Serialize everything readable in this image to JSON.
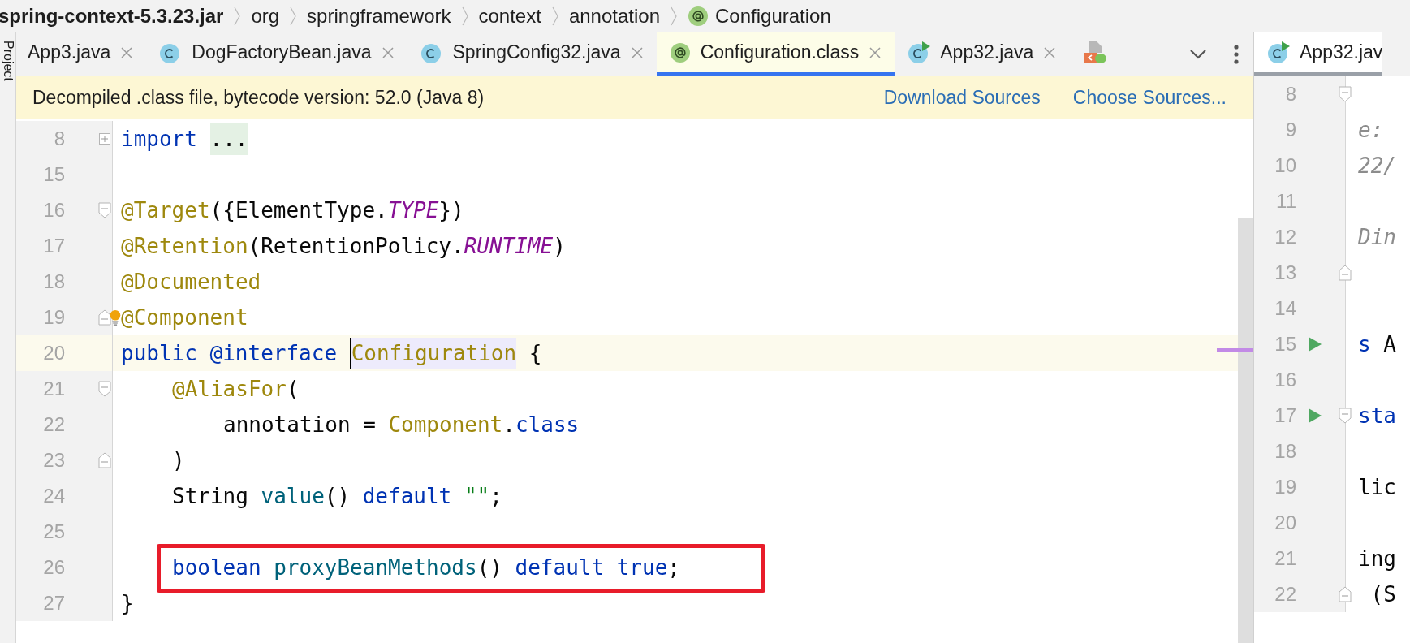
{
  "side_strip": {
    "label": "Project"
  },
  "breadcrumb": [
    {
      "label": "spring-context-5.3.23.jar",
      "kind": "jar"
    },
    {
      "label": "org",
      "kind": "package"
    },
    {
      "label": "springframework",
      "kind": "package"
    },
    {
      "label": "context",
      "kind": "package"
    },
    {
      "label": "annotation",
      "kind": "package"
    },
    {
      "label": "Configuration",
      "kind": "annotation"
    }
  ],
  "tabs": [
    {
      "label": "App3.java",
      "kind": "plain",
      "selected": false
    },
    {
      "label": "DogFactoryBean.java",
      "kind": "class",
      "selected": false
    },
    {
      "label": "SpringConfig32.java",
      "kind": "class",
      "selected": false
    },
    {
      "label": "Configuration.class",
      "kind": "annotation",
      "selected": true
    },
    {
      "label": "App32.java",
      "kind": "runnable",
      "selected": false
    },
    {
      "kind": "spring",
      "selected": false
    }
  ],
  "banner": {
    "text": "Decompiled .class file, bytecode version: 52.0 (Java 8)",
    "links": [
      "Download Sources",
      "Choose Sources..."
    ]
  },
  "editor": {
    "lines": [
      {
        "number": "8",
        "collapsed": true,
        "tokens": [
          {
            "kind": "kw",
            "text": "import"
          },
          {
            "kind": "folded",
            "text": "...",
            "spaced": true
          }
        ]
      },
      {
        "number": "15"
      },
      {
        "number": "16",
        "fold_open": true,
        "tokens": [
          {
            "kind": "ann",
            "text": "@Target"
          },
          {
            "kind": "plain",
            "text": "({ElementType."
          },
          {
            "kind": "const",
            "text": "TYPE"
          },
          {
            "kind": "plain",
            "text": "})"
          }
        ]
      },
      {
        "number": "17",
        "tokens": [
          {
            "kind": "ann",
            "text": "@Retention"
          },
          {
            "kind": "plain",
            "text": "(RetentionPolicy."
          },
          {
            "kind": "const",
            "text": "RUNTIME"
          },
          {
            "kind": "plain",
            "text": ")"
          }
        ]
      },
      {
        "number": "18",
        "tokens": [
          {
            "kind": "ann",
            "text": "@Documented"
          }
        ]
      },
      {
        "number": "19",
        "fold_close": true,
        "bulb": true,
        "tokens": [
          {
            "kind": "ann",
            "text": "@Component"
          }
        ]
      },
      {
        "number": "20",
        "current": true,
        "tokens": [
          {
            "kind": "kw",
            "text": "public"
          },
          {
            "kind": "kw",
            "text": "@interface",
            "spaced": true
          },
          {
            "kind": "ann",
            "text": "Configuration",
            "spaced": true,
            "highlighted": true
          },
          {
            "kind": "plain",
            "text": "{",
            "spaced": true
          }
        ]
      },
      {
        "number": "21",
        "fold_open": true,
        "indented": true,
        "tokens": [
          {
            "kind": "ann",
            "text": "@AliasFor"
          },
          {
            "kind": "plain",
            "text": "("
          }
        ]
      },
      {
        "number": "22",
        "indented": true,
        "deeper": true,
        "tokens": [
          {
            "kind": "plain",
            "text": "annotation"
          },
          {
            "kind": "plain",
            "text": "=",
            "spaced": true
          },
          {
            "kind": "ann",
            "text": "Component",
            "spaced": true
          },
          {
            "kind": "plain",
            "text": "."
          },
          {
            "kind": "kw",
            "text": "class"
          }
        ]
      },
      {
        "number": "23",
        "fold_close": true,
        "indented": true,
        "tokens": [
          {
            "kind": "plain",
            "text": ")"
          }
        ]
      },
      {
        "number": "24",
        "indented": true,
        "tokens": [
          {
            "kind": "plain",
            "text": "String"
          },
          {
            "kind": "method",
            "text": "value",
            "spaced": true
          },
          {
            "kind": "plain",
            "text": "()"
          },
          {
            "kind": "kw",
            "text": "default",
            "spaced": true
          },
          {
            "kind": "str",
            "text": "\"\"",
            "spaced": true
          },
          {
            "kind": "plain",
            "text": ";"
          }
        ]
      },
      {
        "number": "25"
      },
      {
        "number": "26",
        "boxed": true,
        "indented": true,
        "tokens": [
          {
            "kind": "kw",
            "text": "boolean"
          },
          {
            "kind": "method",
            "text": "proxyBeanMethods",
            "spaced": true
          },
          {
            "kind": "plain",
            "text": "()"
          },
          {
            "kind": "kw",
            "text": "default",
            "spaced": true
          },
          {
            "kind": "kw",
            "text": "true",
            "spaced": true
          },
          {
            "kind": "plain",
            "text": ";"
          }
        ]
      },
      {
        "number": "27",
        "tokens": [
          {
            "kind": "plain",
            "text": "}"
          }
        ]
      }
    ]
  },
  "side_editor": {
    "tab": {
      "label": "App32.jav",
      "kind": "runnable",
      "selected": true
    },
    "lines": [
      {
        "number": "8",
        "fold_open": true
      },
      {
        "number": "9",
        "tokens": [
          {
            "kind": "comment",
            "text": "e:"
          }
        ]
      },
      {
        "number": "10",
        "tokens": [
          {
            "kind": "comment",
            "text": "22/"
          }
        ]
      },
      {
        "number": "11"
      },
      {
        "number": "12",
        "tokens": [
          {
            "kind": "comment",
            "text": "Din"
          }
        ]
      },
      {
        "number": "13",
        "fold_close": true
      },
      {
        "number": "14"
      },
      {
        "number": "15",
        "run": true,
        "tokens": [
          {
            "kind": "kw",
            "text": "s"
          },
          {
            "kind": "plain",
            "text": "A",
            "spaced": true
          }
        ]
      },
      {
        "number": "16"
      },
      {
        "number": "17",
        "fold_open": true,
        "run": true,
        "tokens": [
          {
            "kind": "kw",
            "text": "sta"
          }
        ]
      },
      {
        "number": "18"
      },
      {
        "number": "19",
        "tokens": [
          {
            "kind": "plain",
            "text": "lic"
          }
        ]
      },
      {
        "number": "20"
      },
      {
        "number": "21",
        "tokens": [
          {
            "kind": "plain",
            "text": "ing"
          }
        ]
      },
      {
        "number": "22",
        "fold_close": true,
        "tokens": [
          {
            "kind": "plain",
            "text": "(S",
            "spaced": true
          }
        ]
      }
    ]
  }
}
